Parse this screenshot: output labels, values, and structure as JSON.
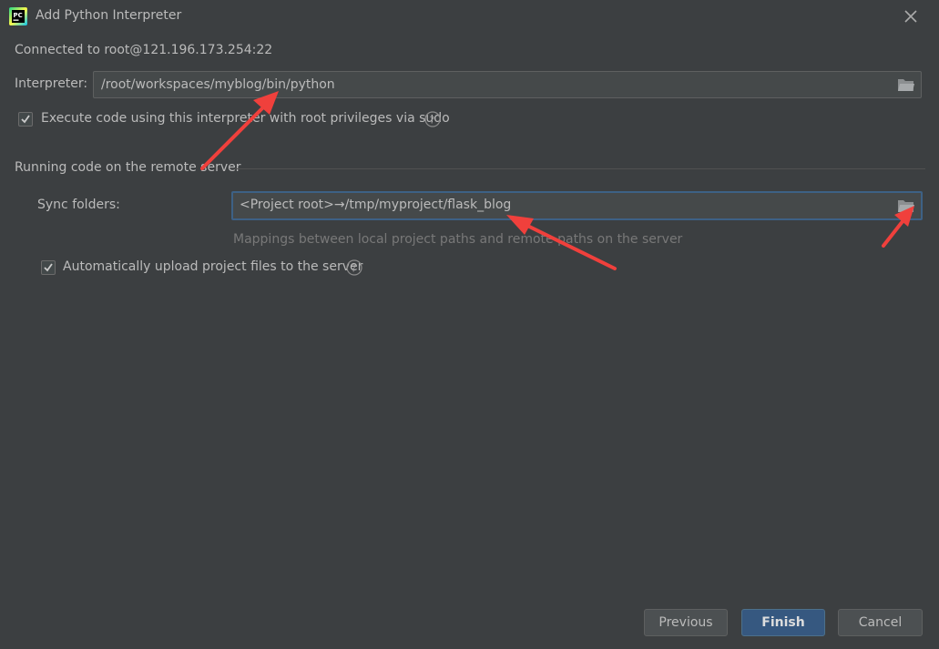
{
  "window": {
    "title": "Add Python Interpreter"
  },
  "connection": {
    "text": "Connected to root@121.196.173.254:22"
  },
  "interpreter": {
    "label": "Interpreter:",
    "value": "/root/workspaces/myblog/bin/python"
  },
  "sudo": {
    "checked": true,
    "label": "Execute code using this interpreter with root privileges via sudo"
  },
  "remote_section": {
    "title": "Running code on the remote server",
    "sync_label": "Sync folders:",
    "sync_value": "<Project root>→/tmp/myproject/flask_blog",
    "hint": "Mappings between local project paths and remote paths on the server",
    "auto_upload_checked": true,
    "auto_upload_label": "Automatically upload project files to the server"
  },
  "buttons": {
    "previous": "Previous",
    "finish": "Finish",
    "cancel": "Cancel"
  },
  "colors": {
    "background": "#3c3f41",
    "primary_button": "#365880",
    "annotation_arrow": "#f0403c"
  },
  "icons": {
    "app": "pycharm-icon",
    "close": "close-icon",
    "folder": "folder-icon",
    "help": "help-icon",
    "check": "checkmark-icon"
  }
}
